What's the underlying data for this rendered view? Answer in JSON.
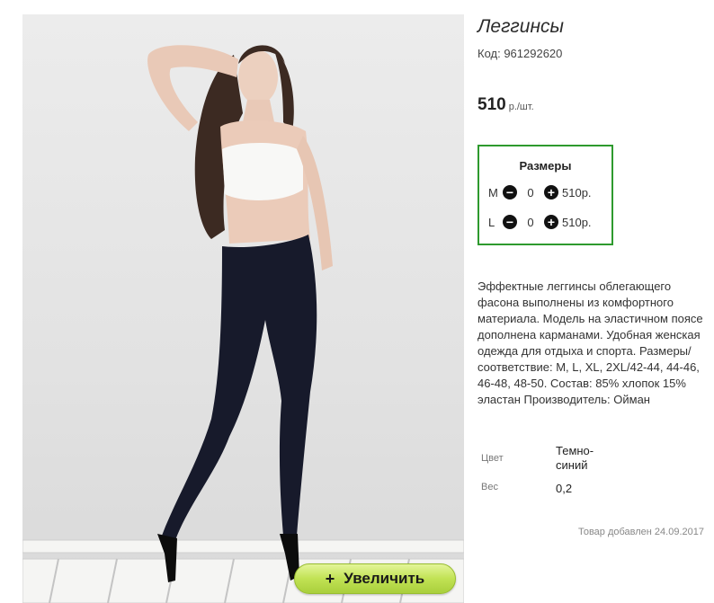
{
  "product": {
    "title": "Леггинсы",
    "code": "Код: 961292620",
    "price": "510",
    "price_unit": "р./шт."
  },
  "sizes": {
    "title": "Размеры",
    "rows": [
      {
        "size": "M",
        "qty": "0",
        "price": "510р."
      },
      {
        "size": "L",
        "qty": "0",
        "price": "510р."
      }
    ]
  },
  "description": "Эффектные леггинсы облегающего фасона выполнены из комфортного материала. Модель на эластичном поясе дополнена карманами. Удобная женская одежда для отдыха и спорта. Размеры/соответствие: M, L, XL, 2XL/42-44, 44-46, 46-48, 48-50. Состав: 85% хлопок 15% эластан Производитель: Ойман",
  "properties": [
    {
      "label": "Цвет",
      "value": "Темно-синий"
    },
    {
      "label": "Вес",
      "value": "0,2"
    }
  ],
  "added_date": "Товар добавлен 24.09.2017",
  "zoom_button": {
    "icon": "+",
    "label": "Увеличить"
  },
  "colors": {
    "size_box_border": "#2e9a2e",
    "zoom_button": "#c1e254"
  }
}
